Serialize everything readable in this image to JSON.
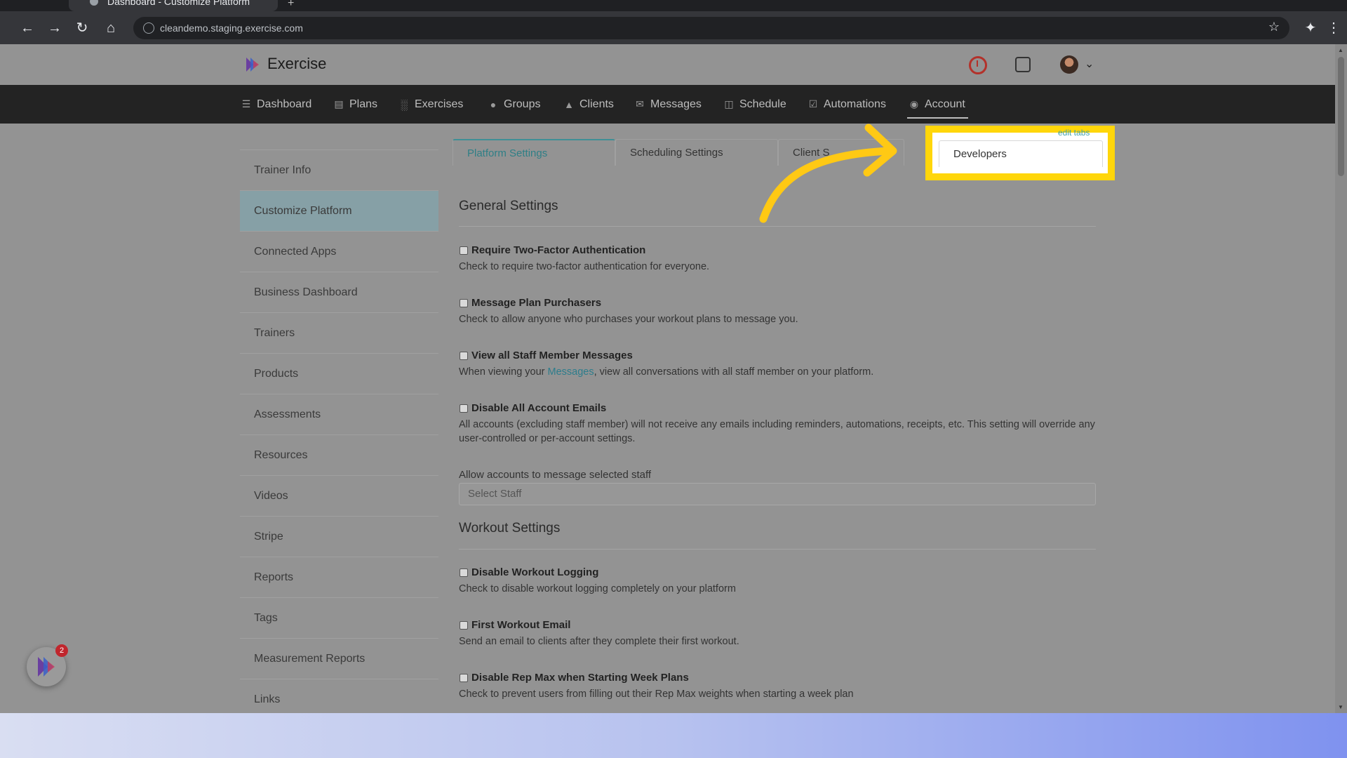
{
  "browser": {
    "tab_title": "Dashboard - Customize Platform",
    "url": "cleandemo.staging.exercise.com"
  },
  "header": {
    "brand": "Exercise"
  },
  "nav": {
    "items": [
      {
        "label": "Dashboard",
        "icon": "list-icon"
      },
      {
        "label": "Plans",
        "icon": "clipboard-icon"
      },
      {
        "label": "Exercises",
        "icon": "dumbbell-icon"
      },
      {
        "label": "Groups",
        "icon": "users-icon"
      },
      {
        "label": "Clients",
        "icon": "user-icon"
      },
      {
        "label": "Messages",
        "icon": "envelope-icon"
      },
      {
        "label": "Schedule",
        "icon": "book-icon"
      },
      {
        "label": "Automations",
        "icon": "check-square-icon"
      },
      {
        "label": "Account",
        "icon": "user-circle-icon"
      }
    ],
    "active": "Account"
  },
  "sidebar": {
    "items": [
      {
        "label": "Trainer Info"
      },
      {
        "label": "Customize Platform"
      },
      {
        "label": "Connected Apps"
      },
      {
        "label": "Business Dashboard"
      },
      {
        "label": "Trainers"
      },
      {
        "label": "Products"
      },
      {
        "label": "Assessments"
      },
      {
        "label": "Resources"
      },
      {
        "label": "Videos"
      },
      {
        "label": "Stripe"
      },
      {
        "label": "Reports"
      },
      {
        "label": "Tags"
      },
      {
        "label": "Measurement Reports"
      },
      {
        "label": "Links"
      }
    ],
    "active": "Customize Platform"
  },
  "tabs": {
    "items": [
      {
        "label": "Platform Settings"
      },
      {
        "label": "Scheduling Settings"
      },
      {
        "label": "Client S"
      },
      {
        "label": "Developers"
      }
    ],
    "active": "Platform Settings",
    "edit_link": "edit tabs"
  },
  "general": {
    "title": "General Settings",
    "settings": [
      {
        "label": "Require Two-Factor Authentication",
        "desc": "Check to require two-factor authentication for everyone."
      },
      {
        "label": "Message Plan Purchasers",
        "desc": "Check to allow anyone who purchases your workout plans to message you."
      },
      {
        "label": "View all Staff Member Messages",
        "desc_before": "When viewing your ",
        "desc_link": "Messages",
        "desc_after": ", view all conversations with all staff member on your platform."
      },
      {
        "label": "Disable All Account Emails",
        "desc": "All accounts (excluding staff member) will not receive any emails including reminders, automations, receipts, etc. This setting will override any user-controlled or per-account settings."
      }
    ],
    "staff_field_label": "Allow accounts to message selected staff",
    "staff_placeholder": "Select Staff"
  },
  "workout": {
    "title": "Workout Settings",
    "settings": [
      {
        "label": "Disable Workout Logging",
        "desc": "Check to disable workout logging completely on your platform"
      },
      {
        "label": "First Workout Email",
        "desc": "Send an email to clients after they complete their first workout."
      },
      {
        "label": "Disable Rep Max when Starting Week Plans",
        "desc": "Check to prevent users from filling out their Rep Max weights when starting a week plan"
      }
    ]
  },
  "widget": {
    "badge_count": "2"
  },
  "colors": {
    "highlight": "#ffd60a",
    "accent_teal": "#2f7f86",
    "arrow": "#ffc914"
  }
}
